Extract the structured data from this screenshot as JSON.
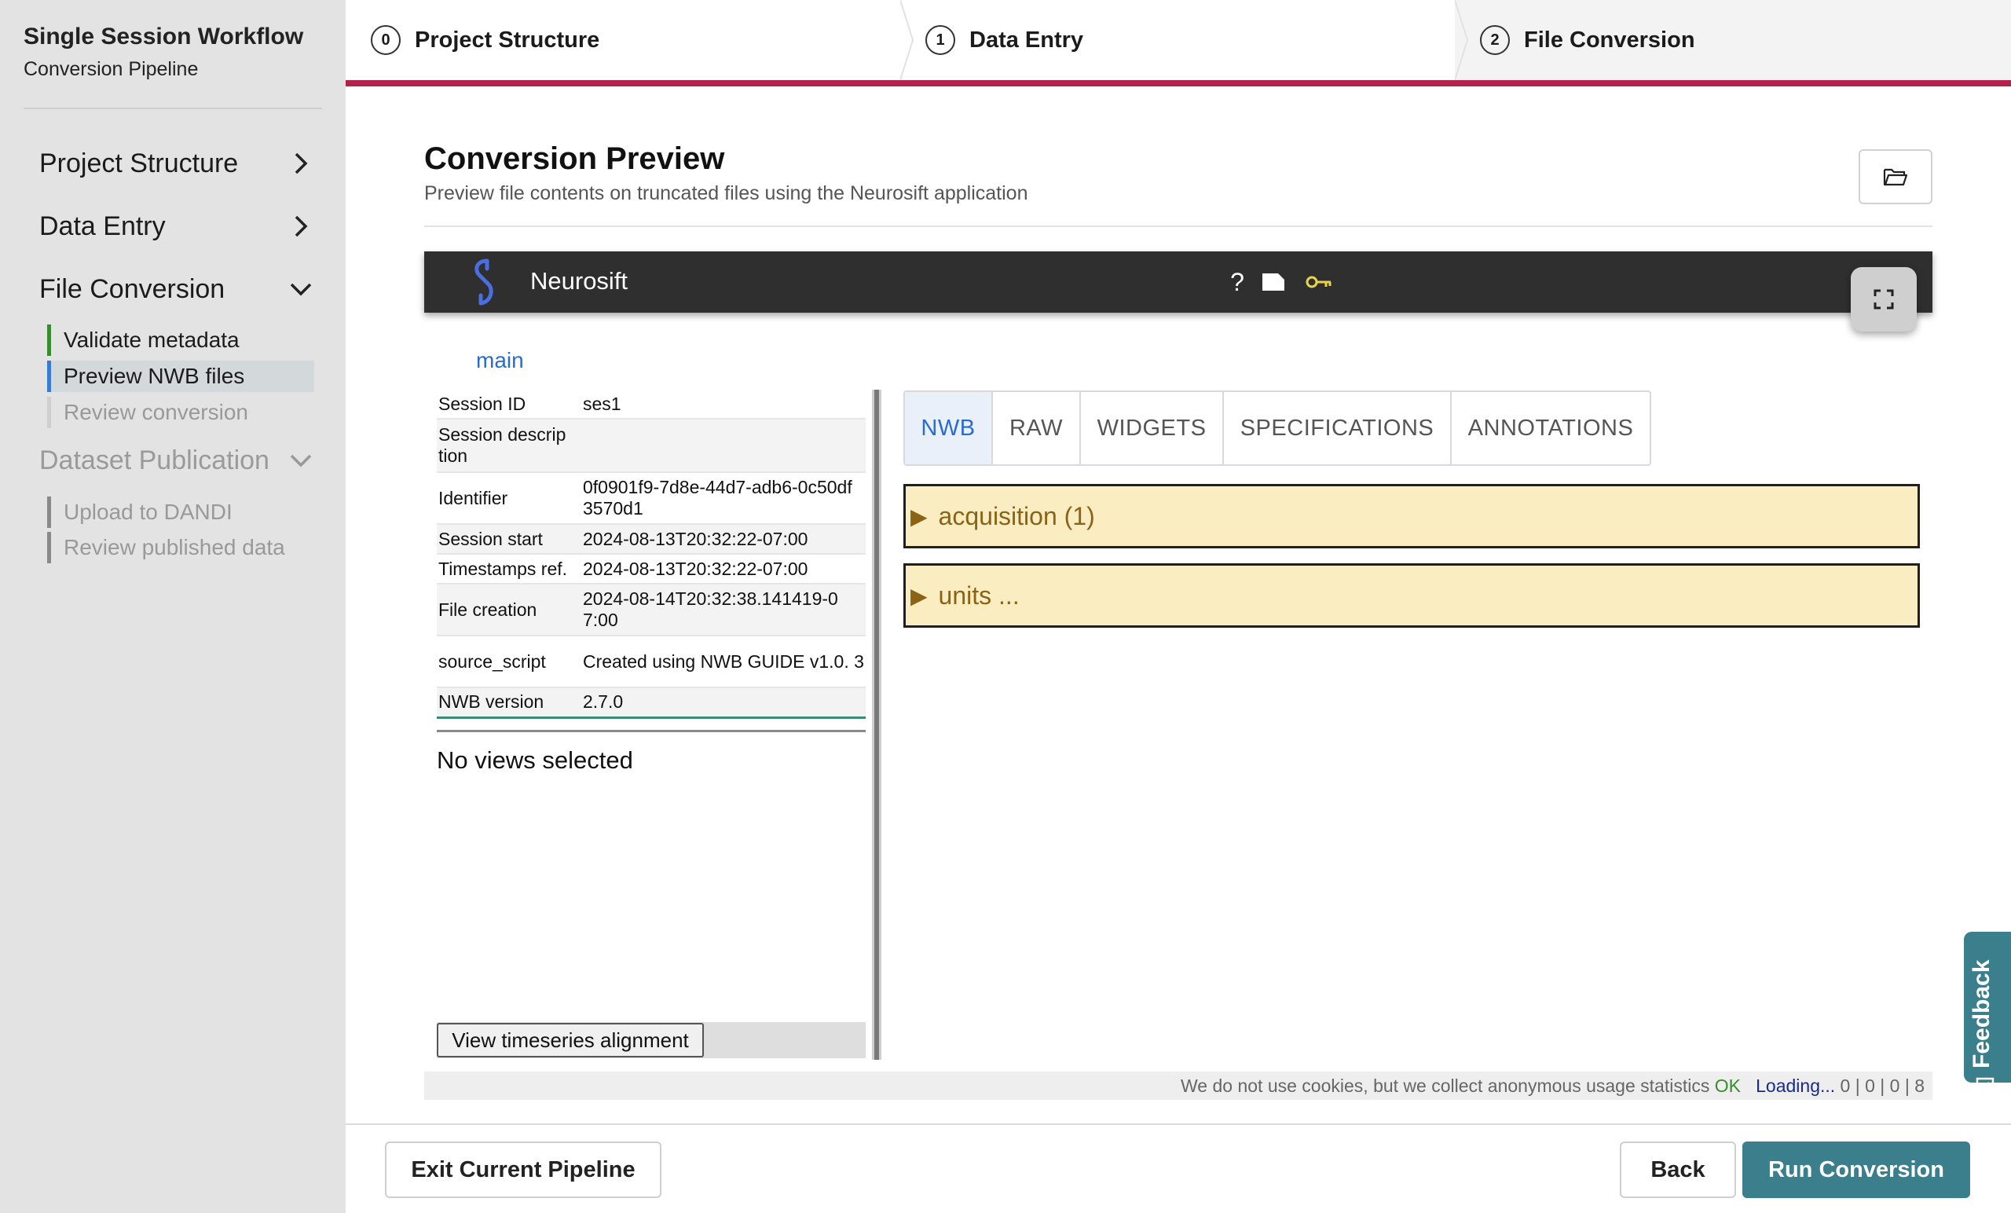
{
  "app": {
    "title": "Single Session Workflow",
    "subtitle": "Conversion Pipeline"
  },
  "sidebar": {
    "sections": [
      {
        "label": "Project Structure",
        "state": "collapsed"
      },
      {
        "label": "Data Entry",
        "state": "collapsed"
      },
      {
        "label": "File Conversion",
        "state": "expanded"
      },
      {
        "label": "Dataset Publication",
        "state": "expanded-disabled"
      }
    ],
    "file_conversion_items": [
      {
        "label": "Validate metadata",
        "status": "done"
      },
      {
        "label": "Preview NWB files",
        "status": "active"
      },
      {
        "label": "Review conversion",
        "status": "pending"
      }
    ],
    "publication_items": [
      {
        "label": "Upload to DANDI"
      },
      {
        "label": "Review published data"
      }
    ]
  },
  "stepper": {
    "steps": [
      {
        "number": "0",
        "label": "Project Structure"
      },
      {
        "number": "1",
        "label": "Data Entry"
      },
      {
        "number": "2",
        "label": "File Conversion"
      }
    ],
    "accent_color": "#b4224b"
  },
  "page": {
    "title": "Conversion Preview",
    "subtitle": "Preview file contents on truncated files using the Neurosift application",
    "folder_icon": "folder-open-icon"
  },
  "neurosift": {
    "app_name": "Neurosift",
    "toolbar_icons": [
      "help-icon",
      "tag-icon",
      "key-icon",
      "fullscreen-icon"
    ],
    "help_glyph": "?",
    "main_tab": "main",
    "file_info": [
      {
        "key": "Session ID",
        "value": "ses1"
      },
      {
        "key": "Session descrip tion",
        "value": ""
      },
      {
        "key": "Identifier",
        "value": "0f0901f9-7d8e-44d7-adb6-0c50df 3570d1"
      },
      {
        "key": "Session start",
        "value": "2024-08-13T20:32:22-07:00"
      },
      {
        "key": "Timestamps ref.",
        "value": "2024-08-13T20:32:22-07:00"
      },
      {
        "key": "File creation",
        "value": "2024-08-14T20:32:38.141419-0 7:00"
      },
      {
        "key": "source_script",
        "value": "Created using NWB GUIDE v1.0. 3"
      },
      {
        "key": "NWB version",
        "value": "2.7.0"
      }
    ],
    "no_views_text": "No views selected",
    "timeseries_button": "View timeseries alignment",
    "tabs": [
      "NWB",
      "RAW",
      "WIDGETS",
      "SPECIFICATIONS",
      "ANNOTATIONS"
    ],
    "active_tab": "NWB",
    "accordions": [
      {
        "label": "acquisition (1)"
      },
      {
        "label": "units ..."
      }
    ],
    "tri_glyph": "▶",
    "footer": {
      "notice": "We do not use cookies, but we collect anonymous usage statistics ",
      "ok": "OK",
      "loading": "Loading...",
      "counts": " 0 | 0 | 0 | 8"
    }
  },
  "actions": {
    "exit": "Exit Current Pipeline",
    "back": "Back",
    "run": "Run Conversion"
  },
  "feedback": {
    "label": "Feedback"
  },
  "colors": {
    "primary": "#3b7e8c",
    "accordion_bg": "#fbedc2",
    "link": "#2a6bd2"
  }
}
